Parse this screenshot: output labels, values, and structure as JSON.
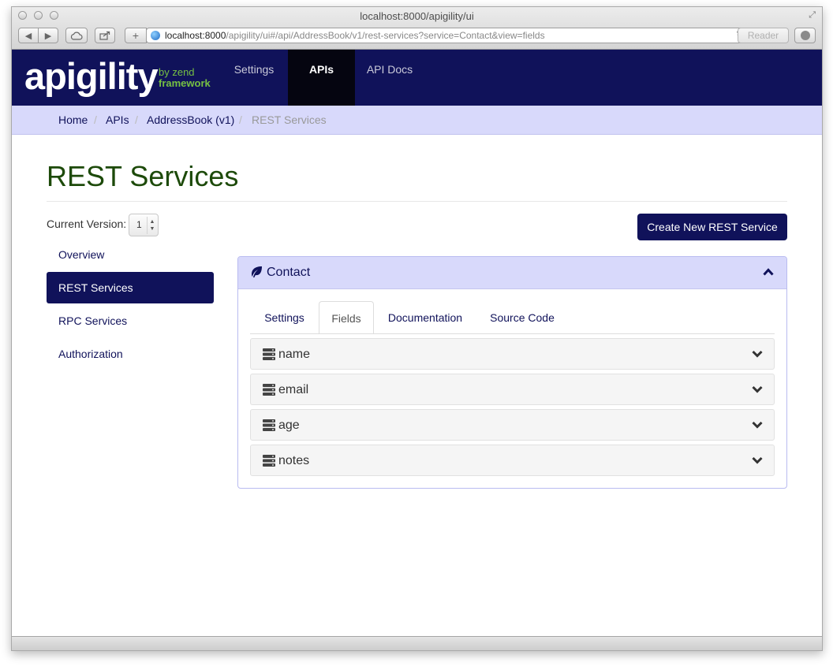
{
  "browser": {
    "window_title": "localhost:8000/apigility/ui",
    "url_host": "localhost:8000",
    "url_rest": "/apigility/ui#/api/AddressBook/v1/rest-services?service=Contact&view=fields",
    "reader_label": "Reader"
  },
  "logo": {
    "main": "apigility",
    "by": "by zend",
    "framework": "framework"
  },
  "nav": {
    "items": [
      {
        "label": "Settings"
      },
      {
        "label": "APIs"
      },
      {
        "label": "API Docs"
      }
    ],
    "active": "APIs"
  },
  "breadcrumb": {
    "items": [
      "Home",
      "APIs",
      "AddressBook (v1)",
      "REST Services"
    ],
    "separator": "/"
  },
  "page": {
    "title": "REST Services",
    "version_label": "Current Version:",
    "version_value": "1",
    "create_button": "Create New REST Service"
  },
  "sidebar": {
    "items": [
      {
        "label": "Overview"
      },
      {
        "label": "REST Services"
      },
      {
        "label": "RPC Services"
      },
      {
        "label": "Authorization"
      }
    ],
    "active": "REST Services"
  },
  "service_panel": {
    "title": "Contact",
    "tabs": [
      {
        "label": "Settings"
      },
      {
        "label": "Fields"
      },
      {
        "label": "Documentation"
      },
      {
        "label": "Source Code"
      }
    ],
    "active_tab": "Fields",
    "fields": [
      {
        "name": "name"
      },
      {
        "name": "email"
      },
      {
        "name": "age"
      },
      {
        "name": "notes"
      }
    ]
  },
  "colors": {
    "brand_navy": "#10125a",
    "title_green": "#1d4a0a",
    "accent_lavender": "#d8d9fb",
    "logo_green": "#76c043"
  },
  "icons": {
    "panel": "leaf-icon",
    "collapse": "chevron-up-icon",
    "field": "database-icon",
    "expand": "chevron-down-icon"
  }
}
